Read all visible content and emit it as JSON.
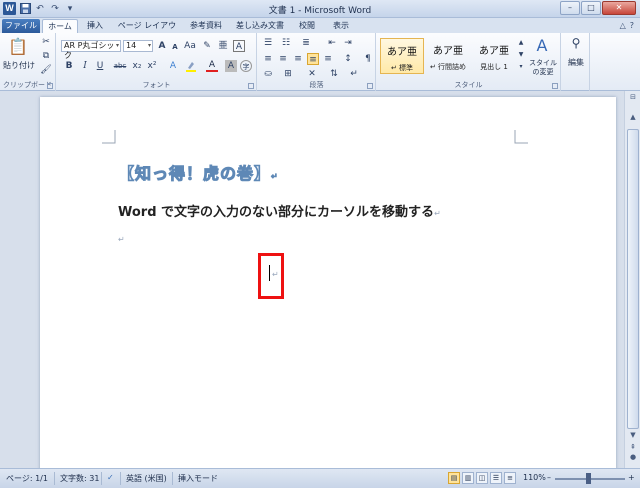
{
  "window": {
    "title": "文書 1 - Microsoft Word",
    "app_icon": "W",
    "minimize": "–",
    "maximize": "□",
    "close": "✕"
  },
  "quick_access": [
    "save-icon",
    "undo-icon",
    "redo-icon",
    "customize-icon"
  ],
  "tabs": [
    "ファイル",
    "ホーム",
    "挿入",
    "ページ レイアウト",
    "参考資料",
    "差し込み文書",
    "校閲",
    "表示"
  ],
  "active_tab": "ホーム",
  "ribbon": {
    "clipboard": {
      "label": "クリップボード",
      "paste": "貼り付け"
    },
    "font": {
      "label": "フォント",
      "font_name": "AR P丸ゴシック",
      "font_size": "14",
      "grow": "A",
      "shrink": "A",
      "change_case": "Aa",
      "bold": "B",
      "italic": "I",
      "underline": "U",
      "strike": "abc",
      "subscript": "x₂",
      "superscript": "x²",
      "font_color": "A",
      "char_shading": "A"
    },
    "paragraph": {
      "label": "段落"
    },
    "styles": {
      "label": "スタイル",
      "items": [
        {
          "sample": "あア亜",
          "name": "↵ 標準"
        },
        {
          "sample": "あア亜",
          "name": "↵ 行間詰め"
        },
        {
          "sample": "あア亜",
          "name": "見出し 1"
        }
      ],
      "change_styles": "スタイルの変更"
    },
    "editing": {
      "label": "編集"
    }
  },
  "document": {
    "heading": "【知っ得！虎の巻】",
    "subheading": "Word で文字の入力のない部分にカーソルを移動する",
    "paragraph_mark": "↵"
  },
  "status": {
    "page": "ページ: 1/1",
    "word_count": "文字数: 31",
    "language": "英語 (米国)",
    "mode": "挿入モード",
    "zoom": "110%",
    "zoom_minus": "–",
    "zoom_plus": "+"
  },
  "colors": {
    "file_tab": "#2c5a9b",
    "highlight_box": "#e11111",
    "heading_stroke": "#5e88b6"
  }
}
